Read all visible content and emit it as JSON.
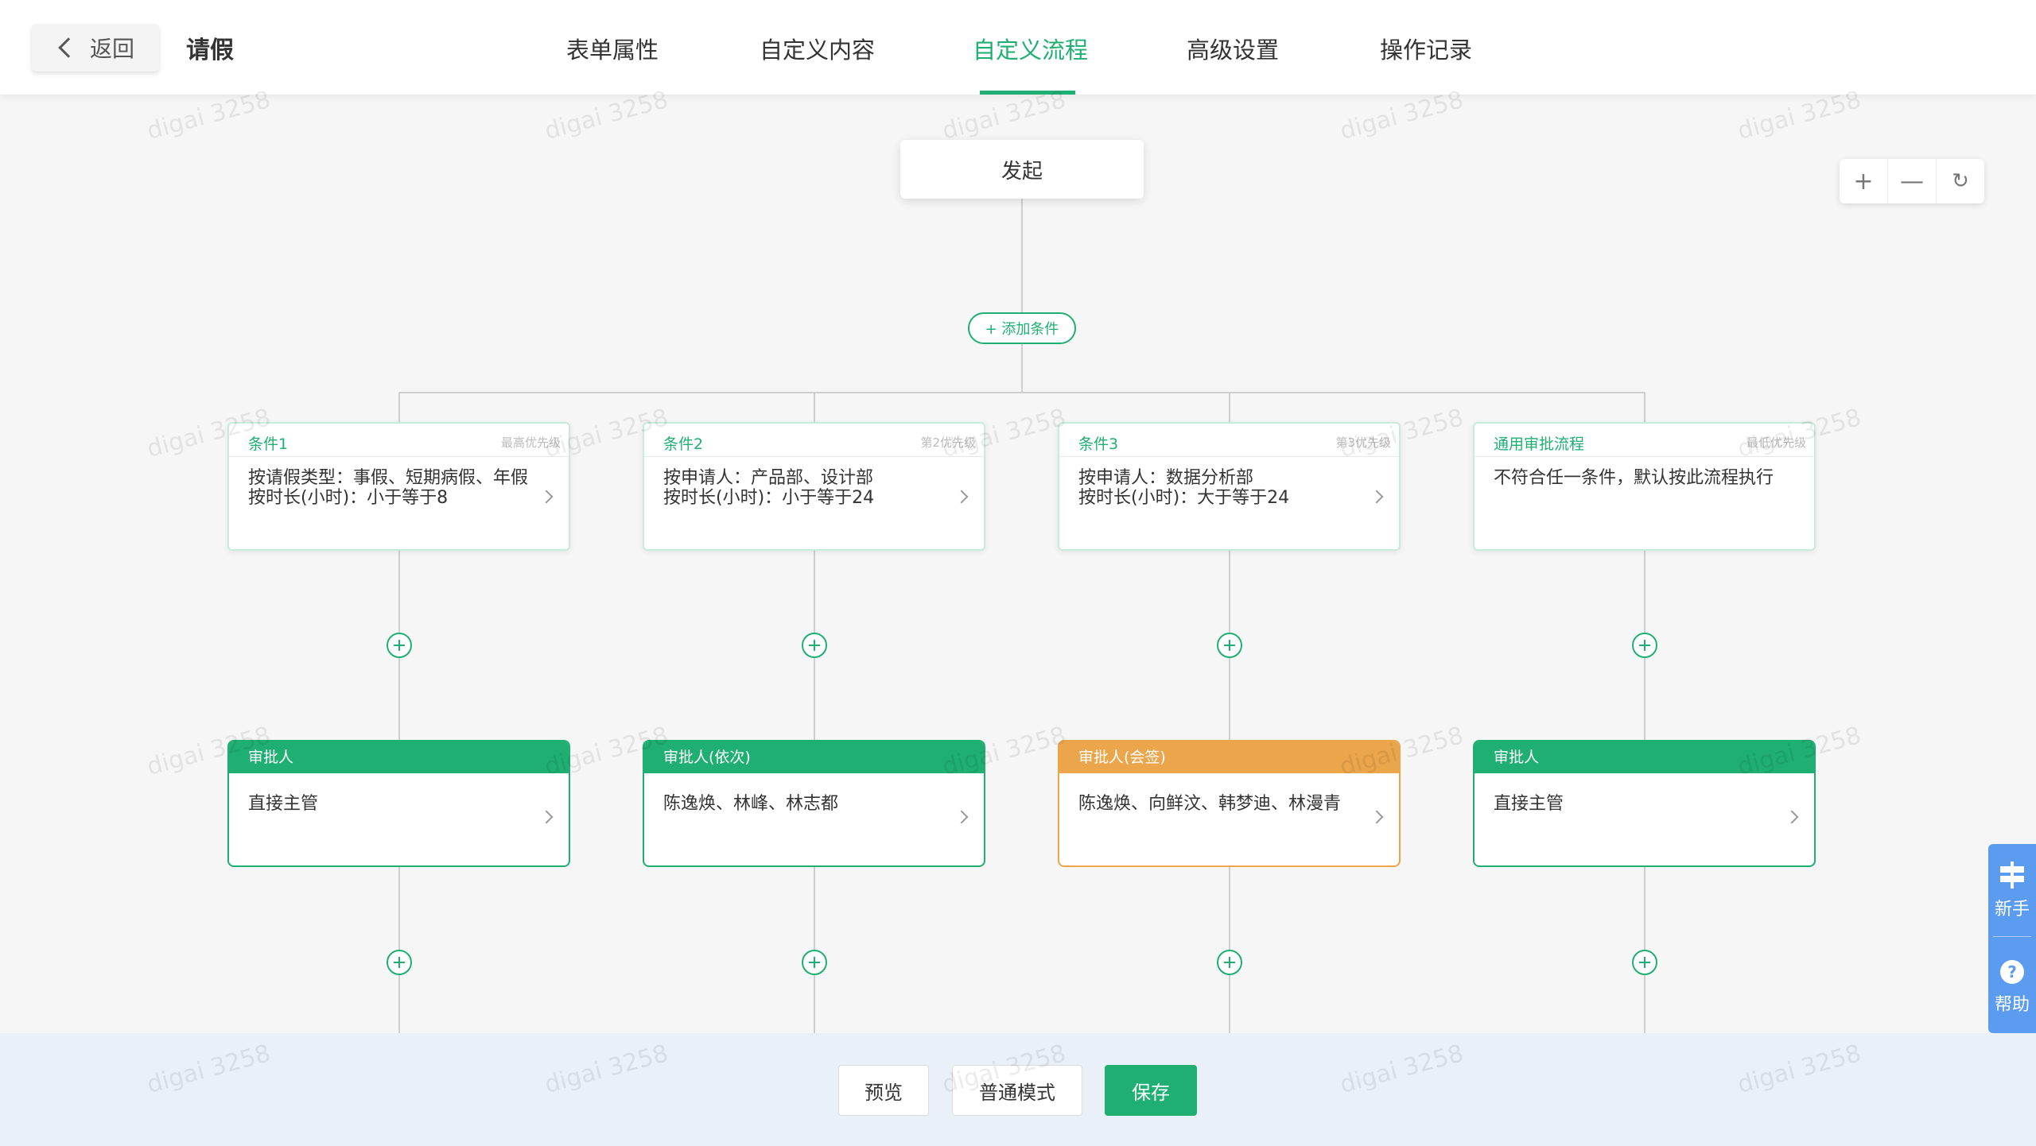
{
  "header": {
    "back_label": "返回",
    "title": "请假",
    "tabs": [
      {
        "label": "表单属性",
        "active": false
      },
      {
        "label": "自定义内容",
        "active": false
      },
      {
        "label": "自定义流程",
        "active": true
      },
      {
        "label": "高级设置",
        "active": false
      },
      {
        "label": "操作记录",
        "active": false
      }
    ]
  },
  "flow": {
    "start_label": "发起",
    "add_condition_label": "+ 添加条件",
    "conditions": [
      {
        "name": "条件1",
        "priority": "最高优先级",
        "lines": [
          "按请假类型：事假、短期病假、年假",
          "按时长(小时)：小于等于8"
        ]
      },
      {
        "name": "条件2",
        "priority": "第2优先级",
        "lines": [
          "按申请人：产品部、设计部",
          "按时长(小时)：小于等于24"
        ]
      },
      {
        "name": "条件3",
        "priority": "第3优先级",
        "lines": [
          "按申请人：数据分析部",
          "按时长(小时)：大于等于24"
        ]
      },
      {
        "name": "通用审批流程",
        "priority": "最低优先级",
        "lines": [
          "不符合任一条件，默认按此流程执行"
        ]
      }
    ],
    "approvers": [
      {
        "title": "审批人",
        "body": "直接主管",
        "color": "#1faf72"
      },
      {
        "title": "审批人(依次)",
        "body": "陈逸焕、林峰、林志都",
        "color": "#1faf72"
      },
      {
        "title": "审批人(会签)",
        "body": "陈逸焕、向鲜汶、韩梦迪、林漫青",
        "color": "#eba54a"
      },
      {
        "title": "审批人",
        "body": "直接主管",
        "color": "#1faf72"
      }
    ]
  },
  "zoom_controls": {
    "zoom_in": "+",
    "zoom_out": "—",
    "reset": "↻"
  },
  "footer": {
    "preview_label": "预览",
    "mode_label": "普通模式",
    "save_label": "保存"
  },
  "side_helper": {
    "guide_label": "新手",
    "help_label": "帮助"
  },
  "watermark": "digai 3258",
  "colors": {
    "accent": "#1faf72",
    "warning": "#eba54a",
    "help": "#5b9bf0"
  }
}
